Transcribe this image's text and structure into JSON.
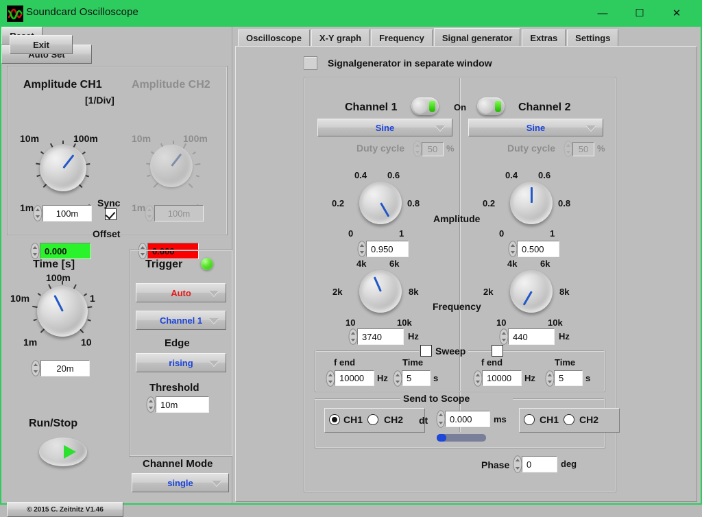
{
  "window": {
    "title": "Soundcard Oscilloscope",
    "icon": "waveform-icon",
    "minimize": "—",
    "maximize": "☐",
    "close": "✕",
    "titlebar_color": "#2ecc5f"
  },
  "left_panel": {
    "exit_label": "Exit",
    "copyright": "© 2015  C. Zeitnitz V1.46",
    "amplitude": {
      "ch1_title": "Amplitude CH1",
      "ch2_title": "Amplitude CH2",
      "unit_title": "[1/Div]",
      "scale_labels": [
        "10m",
        "100m",
        "1m",
        "1"
      ],
      "ch1_value": "100m",
      "ch2_value": "100m",
      "sync_label": "Sync",
      "sync_checked": true,
      "offset_label": "Offset",
      "offset_ch1": "0.000",
      "offset_ch2": "0.000",
      "offset_ch1_color": "#2bf32b",
      "offset_ch2_color": "#fb0000",
      "reset_label": "Reset"
    },
    "time": {
      "title": "Time [s]",
      "scale_labels": [
        "100m",
        "10m",
        "1",
        "1m",
        "10"
      ],
      "value": "20m",
      "run_stop_label": "Run/Stop"
    },
    "trigger": {
      "title": "Trigger",
      "led_color": "#4ee021",
      "mode": "Auto",
      "source": "Channel 1",
      "edge_label": "Edge",
      "edge": "rising",
      "threshold_label": "Threshold",
      "threshold": "10m",
      "auto_set_label": "Auto Set"
    },
    "channel_mode": {
      "label": "Channel Mode",
      "value": "single"
    }
  },
  "tabs": [
    {
      "label": "Oscilloscope",
      "active": false
    },
    {
      "label": "X-Y graph",
      "active": false
    },
    {
      "label": "Frequency",
      "active": false
    },
    {
      "label": "Signal generator",
      "active": true
    },
    {
      "label": "Extras",
      "active": false
    },
    {
      "label": "Settings",
      "active": false
    }
  ],
  "signal_generator": {
    "separate_window_label": "Signalgenerator in separate window",
    "separate_window_checked": false,
    "on_label": "On",
    "amplitude_label": "Amplitude",
    "frequency_label": "Frequency",
    "sweep_label": "Sweep",
    "send_to_scope_label": "Send to Scope",
    "amplitude_scale": [
      "0.4",
      "0.6",
      "0.2",
      "0.8",
      "0",
      "1"
    ],
    "frequency_scale": [
      "4k",
      "6k",
      "2k",
      "8k",
      "10",
      "10k"
    ],
    "dt_label": "dt",
    "dt_value": "0.000",
    "dt_unit": "ms",
    "phase_label": "Phase",
    "phase_value": "0",
    "phase_unit": "deg",
    "channel1": {
      "title": "Channel 1",
      "enabled": true,
      "waveform": "Sine",
      "duty_cycle_label": "Duty cycle",
      "duty_cycle": "50",
      "duty_cycle_unit": "%",
      "amplitude": "0.950",
      "frequency": "3740",
      "frequency_unit": "Hz",
      "sweep_enabled": false,
      "f_end_label": "f end",
      "f_end": "10000",
      "f_end_unit": "Hz",
      "sweep_time_label": "Time",
      "sweep_time": "5",
      "sweep_time_unit": "s",
      "send_ch1_label": "CH1",
      "send_ch2_label": "CH2",
      "send_selected": "CH1"
    },
    "channel2": {
      "title": "Channel 2",
      "enabled": true,
      "waveform": "Sine",
      "duty_cycle_label": "Duty cycle",
      "duty_cycle": "50",
      "duty_cycle_unit": "%",
      "amplitude": "0.500",
      "frequency": "440",
      "frequency_unit": "Hz",
      "sweep_enabled": false,
      "f_end_label": "f end",
      "f_end": "10000",
      "f_end_unit": "Hz",
      "sweep_time_label": "Time",
      "sweep_time": "5",
      "sweep_time_unit": "s",
      "send_ch1_label": "CH1",
      "send_ch2_label": "CH2",
      "send_selected": "none"
    }
  }
}
